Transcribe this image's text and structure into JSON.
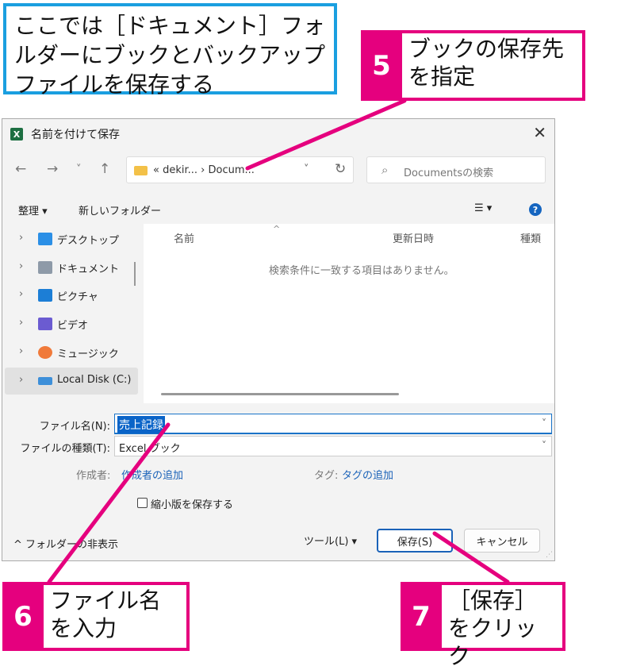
{
  "callouts": {
    "note": "ここでは［ドキュメント］フォルダーにブックとバックアップファイルを保存する",
    "step5": {
      "num": "5",
      "text": "ブックの保存先を指定"
    },
    "step6": {
      "num": "6",
      "text": "ファイル名を入力"
    },
    "step7": {
      "num": "7",
      "text": "［保存］をクリック"
    }
  },
  "colors": {
    "callout_magenta": "#e5007e",
    "note_blue": "#1a9fe0",
    "accent_blue": "#1a62b8"
  },
  "dialog": {
    "title": "名前を付けて保存",
    "app_icon_letter": "X",
    "close_glyph": "✕",
    "nav": {
      "back": "←",
      "forward": "→",
      "recent": "˅",
      "up": "↑"
    },
    "address": {
      "text": "« dekir...  ›  Docum...",
      "chevron": "˅",
      "refresh": "↻"
    },
    "search_placeholder": "Documentsの検索",
    "command_bar": {
      "organize": "整理 ▾",
      "new_folder": "新しいフォルダー",
      "view": "☰ ▾",
      "help": "?"
    },
    "sidebar": {
      "items": [
        {
          "label": "デスクトップ",
          "icon": "desktop-icon",
          "color": "#2b8fe6"
        },
        {
          "label": "ドキュメント",
          "icon": "documents-icon",
          "color": "#8e9aa8"
        },
        {
          "label": "ピクチャ",
          "icon": "pictures-icon",
          "color": "#1c7ed6"
        },
        {
          "label": "ビデオ",
          "icon": "videos-icon",
          "color": "#6b5bd1"
        },
        {
          "label": "ミュージック",
          "icon": "music-icon",
          "color": "#f07a3a"
        },
        {
          "label": "Local Disk (C:)",
          "icon": "drive-icon",
          "color": "#3d8fd9"
        }
      ]
    },
    "columns": {
      "name": "名前",
      "modified": "更新日時",
      "type": "種類"
    },
    "empty_message": "検索条件に一致する項目はありません。",
    "fields": {
      "filename_label": "ファイル名(N):",
      "filename_value": "売上記録",
      "filetype_label": "ファイルの種類(T):",
      "filetype_value": "Excel ブック",
      "authors_label": "作成者:",
      "authors_link": "作成者の追加",
      "tags_label": "タグ:",
      "tags_link": "タグの追加",
      "thumbnail_label": "縮小版を保存する"
    },
    "footer": {
      "hide_folders": "^ フォルダーの非表示",
      "tools": "ツール(L)  ▾",
      "save": "保存(S)",
      "cancel": "キャンセル"
    }
  }
}
